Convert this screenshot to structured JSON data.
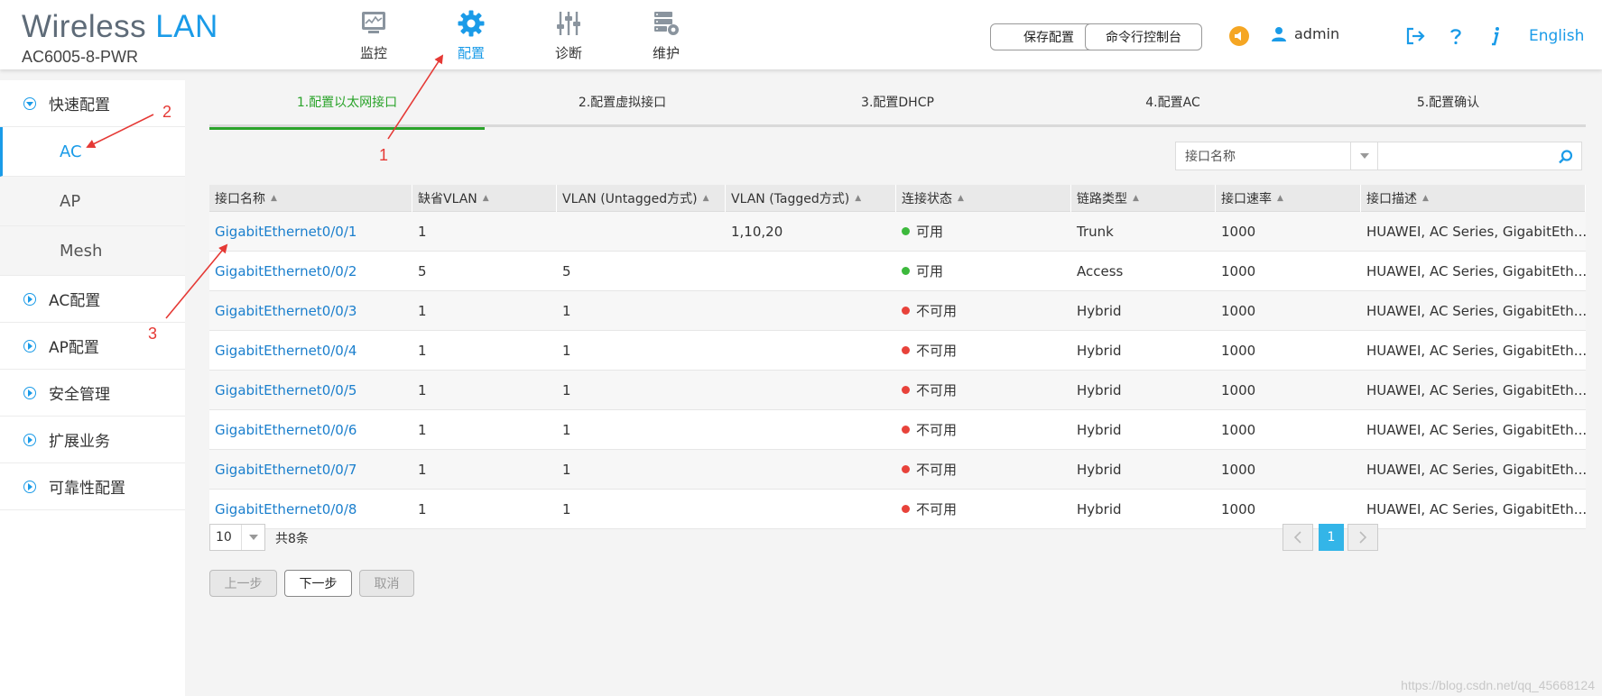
{
  "brand": {
    "title": "Wireless",
    "title_accent": "LAN",
    "model": "AC6005-8-PWR"
  },
  "nav": [
    {
      "label": "监控",
      "icon": "monitor-icon"
    },
    {
      "label": "配置",
      "icon": "gear-icon",
      "active": true
    },
    {
      "label": "诊断",
      "icon": "sliders-icon"
    },
    {
      "label": "维护",
      "icon": "maintenance-icon"
    }
  ],
  "header": {
    "save_label": "保存配置",
    "console_label": "命令行控制台",
    "user": "admin",
    "language": "English"
  },
  "sidebar": {
    "quick": "快速配置",
    "subs": [
      "AC",
      "AP",
      "Mesh"
    ],
    "sections": [
      "AC配置",
      "AP配置",
      "安全管理",
      "扩展业务",
      "可靠性配置"
    ]
  },
  "steps": [
    "1.配置以太网接口",
    "2.配置虚拟接口",
    "3.配置DHCP",
    "4.配置AC",
    "5.配置确认"
  ],
  "filter": {
    "field": "接口名称",
    "value": ""
  },
  "table": {
    "columns": [
      "接口名称",
      "缺省VLAN",
      "VLAN (Untagged方式)",
      "VLAN (Tagged方式)",
      "连接状态",
      "链路类型",
      "接口速率",
      "接口描述"
    ],
    "rows": [
      {
        "name": "GigabitEthernet0/0/1",
        "pvid": "1",
        "untagged": "",
        "tagged": "1,10,20",
        "status": "可用",
        "status_color": "#3cb93c",
        "type": "Trunk",
        "speed": "1000",
        "desc": "HUAWEI, AC Series, GigabitEth..."
      },
      {
        "name": "GigabitEthernet0/0/2",
        "pvid": "5",
        "untagged": "5",
        "tagged": "",
        "status": "可用",
        "status_color": "#3cb93c",
        "type": "Access",
        "speed": "1000",
        "desc": "HUAWEI, AC Series, GigabitEth..."
      },
      {
        "name": "GigabitEthernet0/0/3",
        "pvid": "1",
        "untagged": "1",
        "tagged": "",
        "status": "不可用",
        "status_color": "#e8423a",
        "type": "Hybrid",
        "speed": "1000",
        "desc": "HUAWEI, AC Series, GigabitEth..."
      },
      {
        "name": "GigabitEthernet0/0/4",
        "pvid": "1",
        "untagged": "1",
        "tagged": "",
        "status": "不可用",
        "status_color": "#e8423a",
        "type": "Hybrid",
        "speed": "1000",
        "desc": "HUAWEI, AC Series, GigabitEth..."
      },
      {
        "name": "GigabitEthernet0/0/5",
        "pvid": "1",
        "untagged": "1",
        "tagged": "",
        "status": "不可用",
        "status_color": "#e8423a",
        "type": "Hybrid",
        "speed": "1000",
        "desc": "HUAWEI, AC Series, GigabitEth..."
      },
      {
        "name": "GigabitEthernet0/0/6",
        "pvid": "1",
        "untagged": "1",
        "tagged": "",
        "status": "不可用",
        "status_color": "#e8423a",
        "type": "Hybrid",
        "speed": "1000",
        "desc": "HUAWEI, AC Series, GigabitEth..."
      },
      {
        "name": "GigabitEthernet0/0/7",
        "pvid": "1",
        "untagged": "1",
        "tagged": "",
        "status": "不可用",
        "status_color": "#e8423a",
        "type": "Hybrid",
        "speed": "1000",
        "desc": "HUAWEI, AC Series, GigabitEth..."
      },
      {
        "name": "GigabitEthernet0/0/8",
        "pvid": "1",
        "untagged": "1",
        "tagged": "",
        "status": "不可用",
        "status_color": "#e8423a",
        "type": "Hybrid",
        "speed": "1000",
        "desc": "HUAWEI, AC Series, GigabitEth..."
      }
    ]
  },
  "pager": {
    "size": "10",
    "total": "共8条",
    "current": "1"
  },
  "actions": {
    "prev": "上一步",
    "next": "下一步",
    "cancel": "取消"
  },
  "watermark": "https://blog.csdn.net/qq_45668124",
  "annotations": [
    "1",
    "2",
    "3"
  ],
  "colors": {
    "accent": "#1a9be8",
    "step_active": "#2aa32a",
    "link": "#1b7fcd",
    "annotation": "#e53935"
  }
}
